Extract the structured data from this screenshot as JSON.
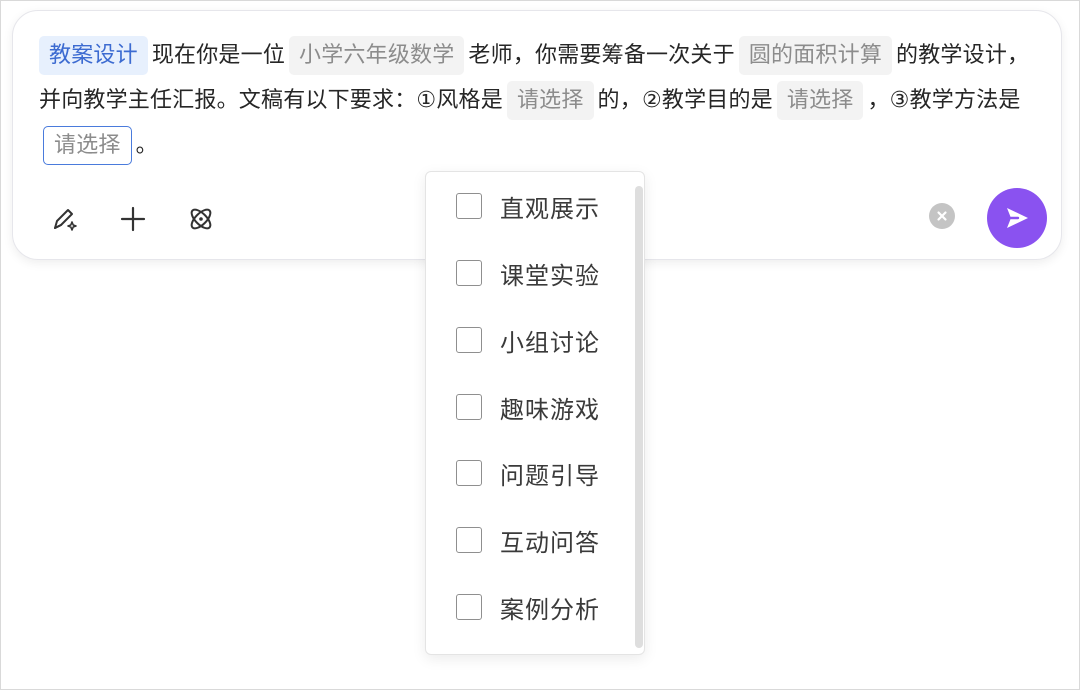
{
  "prompt": {
    "tag_label": "教案设计",
    "text_1": "现在你是一位",
    "grade_value": "小学六年级数学",
    "text_2": "老师，你需要筹备一次关于",
    "topic_value": "圆的面积计算",
    "text_3": "的教学设计，并向教学主任汇报。文稿有以下要求：①风格是",
    "style_placeholder": "请选择",
    "text_4": "的，②教学目的是",
    "goal_placeholder": "请选择",
    "text_5": "，③教学方法是",
    "method_placeholder": "请选择",
    "text_6": "。"
  },
  "toolbar": {
    "icons": [
      "edit-sparkle-icon",
      "plus-icon",
      "atom-icon"
    ]
  },
  "actions": {
    "clear_icon": "clear-icon",
    "send_icon": "send-icon",
    "send_color": "#8a52f0"
  },
  "dropdown": {
    "options": [
      {
        "label": "直观展示",
        "checked": false
      },
      {
        "label": "课堂实验",
        "checked": false
      },
      {
        "label": "小组讨论",
        "checked": false
      },
      {
        "label": "趣味游戏",
        "checked": false
      },
      {
        "label": "问题引导",
        "checked": false
      },
      {
        "label": "互动问答",
        "checked": false
      },
      {
        "label": "案例分析",
        "checked": false
      }
    ]
  }
}
